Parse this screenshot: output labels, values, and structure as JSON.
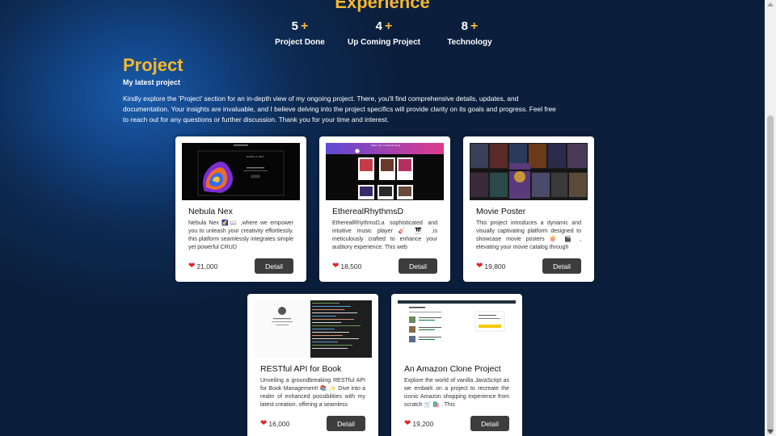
{
  "experience": {
    "title": "Experience",
    "stats": [
      {
        "value": "5",
        "plus": "+",
        "label": "Project Done"
      },
      {
        "value": "4",
        "plus": "+",
        "label": "Up Coming Project"
      },
      {
        "value": "8",
        "plus": "+",
        "label": "Technology"
      }
    ]
  },
  "project_section": {
    "title": "Project",
    "subtitle": "My latest project",
    "description": "Kindly explore the 'Project' section for an in-depth view of my ongoing project. There, you'll find comprehensive details, updates, and documentation. Your insights are invaluable, and I believe delving into the project specifics will provide clarity on its goals and progress. Feel free to reach out for any questions or further discussion. Thank you for your time and interest."
  },
  "projects": [
    {
      "title": "Nebula Nex",
      "description": "Nebula Nex 🌠📖 ,where we empower you to unleash your creativity effortlessly. this platform seamlessly integrates simple yet powerful CRUD",
      "likes": "21,000",
      "button": "Detail"
    },
    {
      "title": "EtherealRhythmsD",
      "description": "EtherealRhythmsD,a sophisticated and intuitive music player 🎸 🎹 ,is meticulously crafted to enhance your auditory experience. This web",
      "likes": "18,500",
      "button": "Detail"
    },
    {
      "title": "Movie Poster",
      "description": "This project introduces a dynamic and visually captivating platform designed to showcase movie posters 🍿 🎬 , elevating your movie catalog through",
      "likes": "19,800",
      "button": "Detail"
    },
    {
      "title": "RESTful API for Book",
      "description": "Unveiling a groundbreaking RESTful API for Book Management! 📚 ✨ Dive into a realm of enhanced possibilities with my latest creation, offering a seamless",
      "likes": "16,000",
      "button": "Detail"
    },
    {
      "title": "An Amazon Clone Project",
      "description": "Explore the world of vanilla JavaScript as we embark on a project to recreate the iconic Amazon shopping experience from scratch 🛒 🛍️ . This",
      "likes": "19,200",
      "button": "Detail"
    }
  ],
  "thumb_labels": {
    "nebula_brand": "NEBULA NEX",
    "ethereal_header": "Make Your 7 Favorite Song"
  },
  "colors": {
    "accent": "#f5b82e",
    "background": "#0b1f3d",
    "button": "#3d3d3d",
    "heart": "#e02424"
  }
}
